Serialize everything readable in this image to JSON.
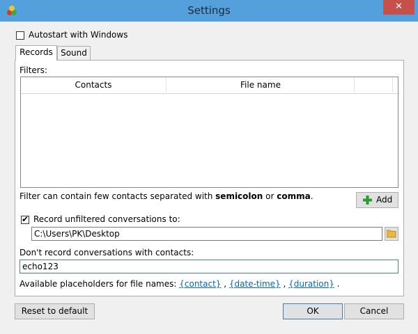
{
  "window": {
    "title": "Settings",
    "close_glyph": "✕"
  },
  "autostart": {
    "label": "Autostart with Windows",
    "checked": false
  },
  "tabs": [
    {
      "label": "Records",
      "active": true
    },
    {
      "label": "Sound",
      "active": false
    }
  ],
  "records": {
    "filters_label": "Filters:",
    "columns": [
      "Contacts",
      "File name"
    ],
    "hint_prefix": "Filter can contain few contacts separated with ",
    "hint_semicolon": "semicolon",
    "hint_or": " or ",
    "hint_comma": "comma",
    "hint_suffix": ".",
    "add_label": "Add",
    "record_unfiltered": {
      "label": "Record unfiltered conversations to:",
      "checked": true
    },
    "path_value": "C:\\Users\\PK\\Desktop",
    "dont_record_label": "Don't record conversations with contacts:",
    "dont_record_value": "echo123",
    "placeholders_prefix": "Available placeholders for file names: ",
    "placeholders": [
      "{contact}",
      "{date-time}",
      "{duration}"
    ],
    "placeholder_sep": " , ",
    "placeholder_end": " ."
  },
  "buttons": {
    "reset": "Reset to default",
    "ok": "OK",
    "cancel": "Cancel"
  },
  "icons": {
    "app": "app-icon",
    "add": "plus-icon",
    "browse": "folder-icon"
  }
}
